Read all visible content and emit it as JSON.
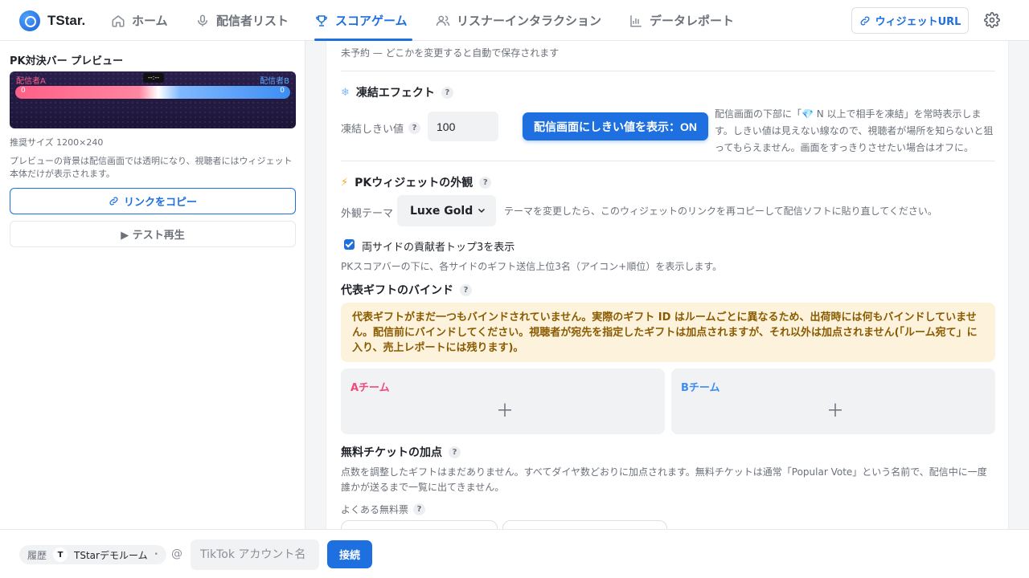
{
  "app": {
    "name": "TStar."
  },
  "nav": {
    "items": [
      {
        "label": "ホーム",
        "icon": "home-icon"
      },
      {
        "label": "配信者リスト",
        "icon": "microphone-icon"
      },
      {
        "label": "スコアゲーム",
        "icon": "trophy-icon",
        "active": true
      },
      {
        "label": "リスナーインタラクション",
        "icon": "users-icon"
      },
      {
        "label": "データレポート",
        "icon": "bar-chart-icon"
      }
    ],
    "widget_url_label": "ウィジェットURL"
  },
  "preview": {
    "title": "PK対決バー プレビュー",
    "streamer_a": "配信者A",
    "streamer_b": "配信者B",
    "timer": "--:--",
    "score_a": "0",
    "score_b": "0",
    "recommended_size": "推奨サイズ 1200×240",
    "note": "プレビューの背景は配信画面では透明になり、視聴者にはウィジェット本体だけが表示されます。",
    "copy_link_label": "リンクをコピー",
    "test_play_label": "▶ テスト再生"
  },
  "settings": {
    "save_status": "未予約 — どこかを変更すると自動で保存されます",
    "freeze": {
      "title": "凍結エフェクト",
      "threshold_label": "凍結しきい値",
      "threshold_value": "100",
      "show_threshold_button": "配信画面にしきい値を表示：ON",
      "description": "配信画面の下部に「💎 N 以上で相手を凍結」を常時表示します。しきい値は見えない線なので、視聴者が場所を知らないと狙ってもらえません。画面をすっきりさせたい場合はオフに。"
    },
    "appearance": {
      "title": "PKウィジェットの外観",
      "theme_label": "外観テーマ",
      "theme_value": "Luxe Gold",
      "theme_hint": "テーマを変更したら、このウィジェットのリンクを再コピーして配信ソフトに貼り直してください。",
      "show_top3_label": "両サイドの貢献者トップ3を表示",
      "show_top3_checked": true,
      "show_top3_hint": "PKスコアバーの下に、各サイドのギフト送信上位3名（アイコン+順位）を表示します。"
    },
    "gift_binding": {
      "title": "代表ギフトのバインド",
      "warning": "代表ギフトがまだ一つもバインドされていません。実際のギフト ID はルームごとに異なるため、出荷時には何もバインドしていません。配信前にバインドしてください。視聴者が宛先を指定したギフトは加点されますが、それ以外は加点されません(「ルーム宛て」に入り、売上レポートには残ります)。",
      "team_a": "Aチーム",
      "team_b": "Bチーム"
    },
    "free_ticket": {
      "title": "無料チケットの加点",
      "description": "点数を調整したギフトはまだありません。すべてダイヤ数どおりに加点されます。無料チケットは通常「Popular Vote」という名前で、配信中に一度誰かが送るまで一覧に出てきません。",
      "common_label": "よくある無料票"
    }
  },
  "bottom": {
    "history_label": "履歴",
    "room_badge": "T",
    "room_name": "TStarデモルーム",
    "at_symbol": "@",
    "account_placeholder": "TikTok アカウント名",
    "connect_label": "接続"
  },
  "colors": {
    "accent": "#1e6fe0",
    "team_a": "#f04b7c",
    "team_b": "#3d8df2",
    "warning_bg": "#fdf3dc",
    "warning_text": "#8a5a00"
  }
}
